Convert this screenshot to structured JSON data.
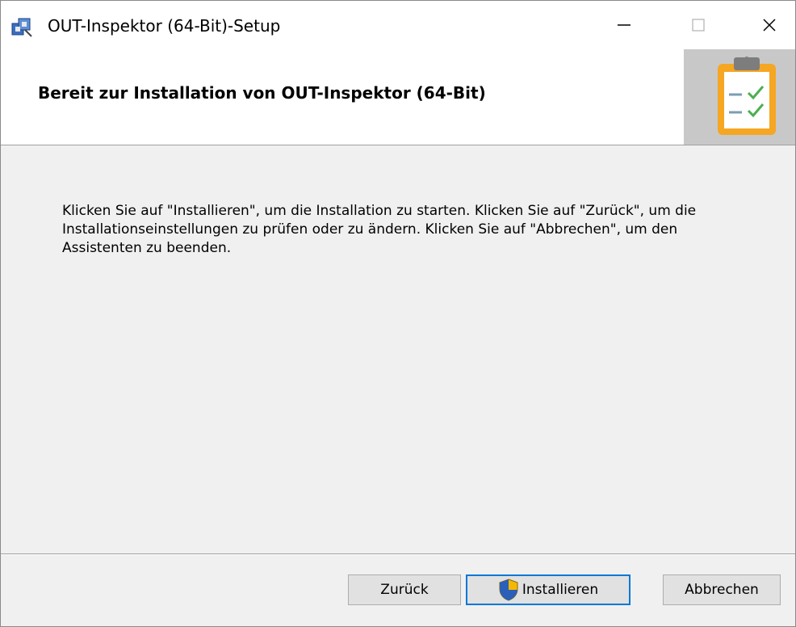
{
  "window": {
    "title": "OUT-Inspektor (64-Bit)-Setup",
    "app_icon": "installer-package-icon",
    "controls": {
      "minimize_glyph": "—",
      "maximize_glyph": "☐",
      "close_glyph": "✕"
    }
  },
  "header": {
    "title": "Bereit zur Installation von OUT-Inspektor (64-Bit)",
    "graphic_icon": "clipboard-checklist-icon"
  },
  "body": {
    "message": "Klicken Sie auf \"Installieren\", um die Installation zu starten. Klicken Sie auf \"Zurück\", um die Installationseinstellungen zu prüfen oder zu ändern. Klicken Sie auf \"Abbrechen\", um den Assistenten zu beenden."
  },
  "buttons": {
    "back_label": "Zurück",
    "install_label": "Installieren",
    "install_icon": "uac-shield-icon",
    "cancel_label": "Abbrechen"
  },
  "colors": {
    "accent": "#0078d7",
    "clipboard": "#f5a623",
    "face": "#f0f0f0"
  }
}
